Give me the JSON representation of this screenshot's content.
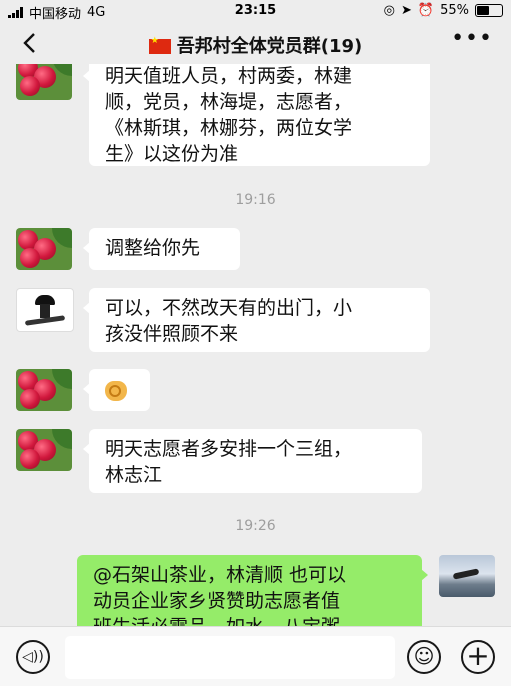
{
  "status_bar": {
    "carrier": "中国移动",
    "network": "4G",
    "time": "23:15",
    "battery_percent": "55%",
    "battery_level": 0.55,
    "icons": [
      "signal-icon",
      "location-icon",
      "alarm-icon",
      "orientation-lock-icon",
      "battery-icon"
    ]
  },
  "header": {
    "back_icon": "back-chevron-icon",
    "flag_icon": "china-flag-icon",
    "title": "吾邦村全体党员群(19)",
    "more_icon": "more-dots-icon"
  },
  "messages": [
    {
      "sender": "other",
      "avatar": "raspberry-avatar",
      "lines": [
        "明天值班人员，村两委，林建",
        "顺，党员，林海堤，志愿者，",
        "《林斯琪，林娜芬，两位女学",
        "生》以这份为准"
      ]
    },
    {
      "type": "time",
      "text": "19:16"
    },
    {
      "sender": "other",
      "avatar": "raspberry-avatar",
      "lines": [
        "调整给你先"
      ]
    },
    {
      "sender": "other",
      "avatar": "mushroom-avatar",
      "lines": [
        "可以，不然改天有的出门，小",
        "孩没伴照顾不来"
      ]
    },
    {
      "sender": "other",
      "avatar": "raspberry-avatar",
      "emoji": "ok-hand-emoji"
    },
    {
      "sender": "other",
      "avatar": "raspberry-avatar",
      "lines": [
        "明天志愿者多安排一个三组，",
        "林志江"
      ]
    },
    {
      "type": "time",
      "text": "19:26"
    },
    {
      "sender": "me",
      "avatar": "photo-avatar",
      "lines": [
        "@石架山茶业，林清顺 也可以",
        "动员企业家乡贤赞助志愿者值",
        "班生活必需品，如水，八宝粥"
      ]
    }
  ],
  "input_bar": {
    "voice_icon": "voice-icon",
    "text_value": "",
    "emoji_icon": "emoji-icon",
    "plus_icon": "plus-icon"
  },
  "colors": {
    "background": "#ededed",
    "my_bubble": "#95ec69",
    "other_bubble": "#ffffff",
    "timestamp": "#9e9e9e"
  }
}
